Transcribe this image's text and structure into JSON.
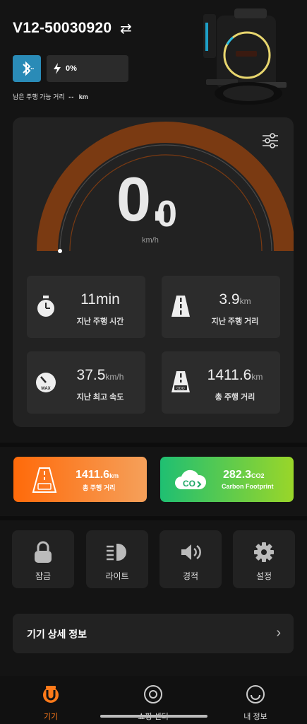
{
  "header": {
    "device_name": "V12-50030920",
    "swap_symbol": "⇄",
    "battery_pct": "0%",
    "range_label": "남은 주행 가능 거리",
    "range_value": "--",
    "range_unit": "km"
  },
  "speedometer": {
    "speed_int": "0.",
    "speed_dec": "0",
    "unit": "km/h",
    "arc_color": "#7a3a12"
  },
  "stats": [
    {
      "value": "11",
      "unit": "min",
      "label": "지난 주행 시간",
      "icon": "stopwatch-icon"
    },
    {
      "value": "3.9",
      "unit": "km",
      "label": "지난 주행 거리",
      "icon": "road-icon"
    },
    {
      "value": "37.5",
      "unit": "km/h",
      "label": "지난 최고 속도",
      "icon": "gauge-max-icon"
    },
    {
      "value": "1411.6",
      "unit": "km",
      "label": "총 주행 거리",
      "icon": "odometer-road-icon"
    }
  ],
  "promos": {
    "odometer": {
      "value": "1411.6",
      "unit": "km",
      "label": "총 주행 거리"
    },
    "carbon": {
      "value": "282.3",
      "unit": "CO2",
      "label": "Carbon Footprint"
    }
  },
  "quick_actions": [
    {
      "label": "잠금",
      "icon": "lock-icon"
    },
    {
      "label": "라이트",
      "icon": "headlight-icon"
    },
    {
      "label": "경적",
      "icon": "horn-icon"
    },
    {
      "label": "설정",
      "icon": "gear-icon"
    }
  ],
  "detail": {
    "label": "기기 상세 정보",
    "chevron": "›"
  },
  "nav": [
    {
      "label": "기기",
      "icon": "device-icon",
      "active": true
    },
    {
      "label": "쇼핑 센터",
      "icon": "shop-icon",
      "active": false
    },
    {
      "label": "내 정보",
      "icon": "profile-icon",
      "active": false
    }
  ],
  "colors": {
    "accent_orange": "#ff7a1a",
    "accent_green": "#4fd25a",
    "bluetooth": "#2a8bb7"
  }
}
